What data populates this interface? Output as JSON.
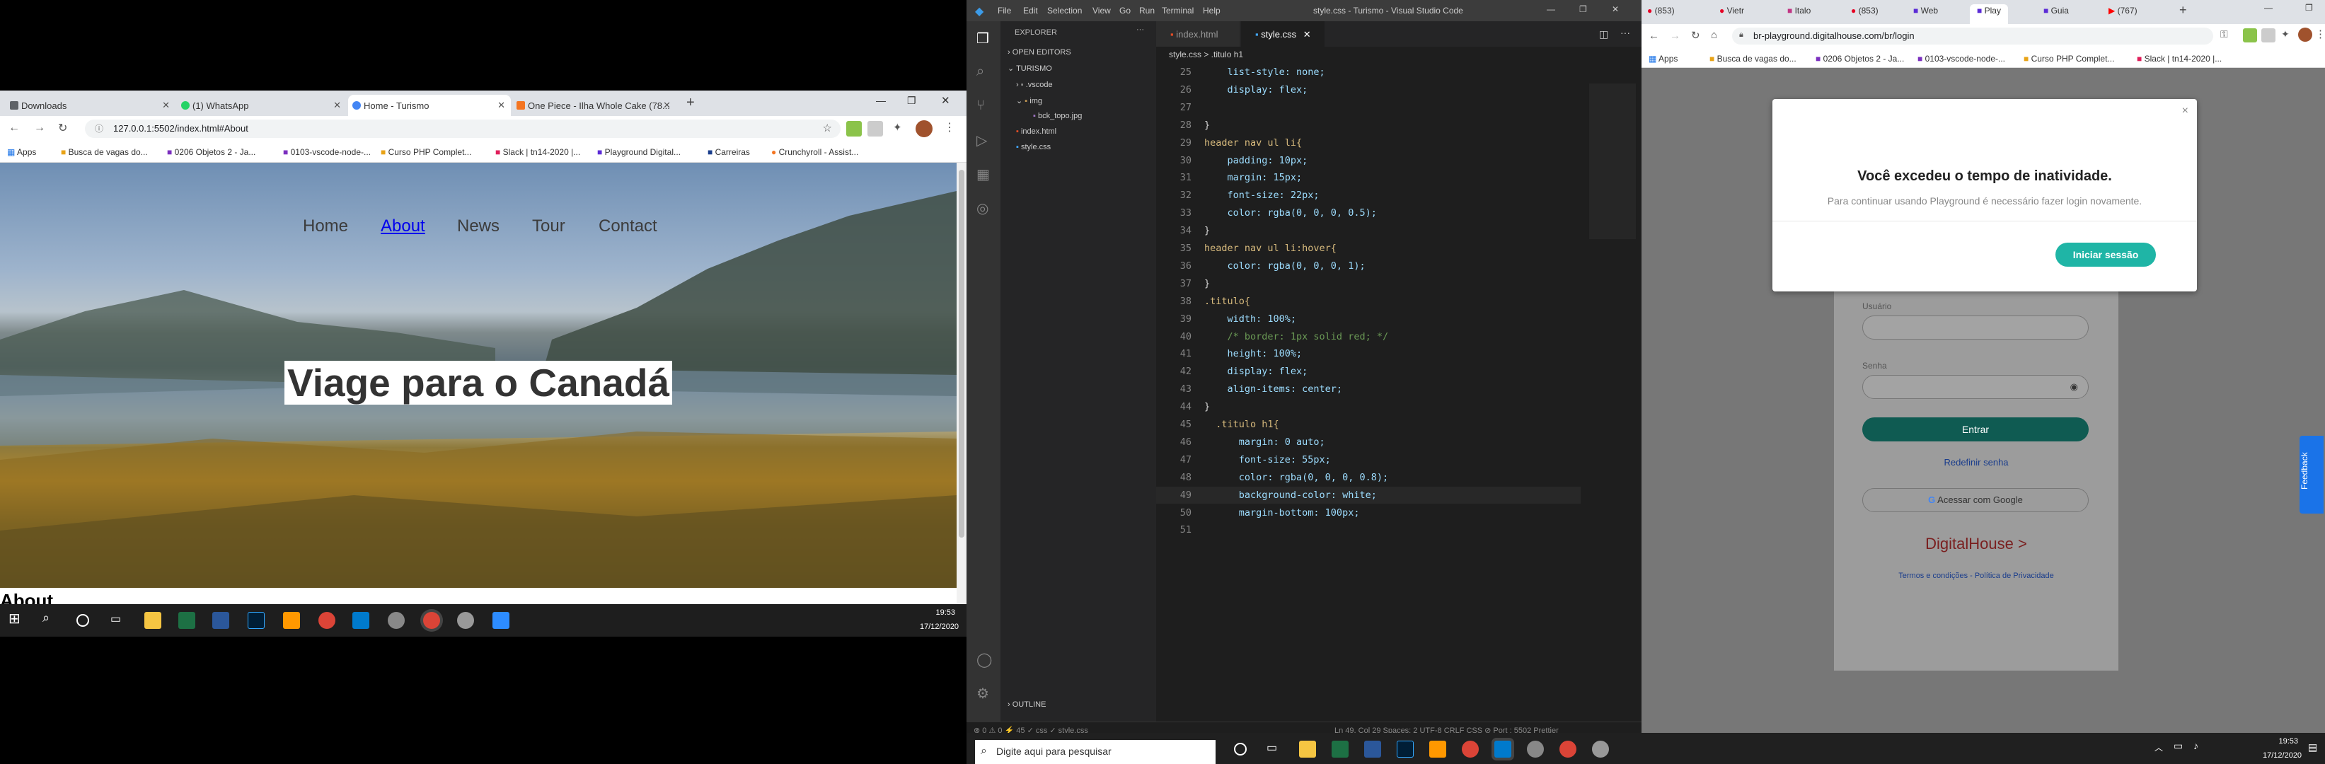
{
  "left_browser": {
    "tabs": [
      {
        "label": "Downloads"
      },
      {
        "label": "(1) WhatsApp"
      },
      {
        "label": "Home - Turismo"
      },
      {
        "label": "One Piece - Ilha Whole Cake (78..."
      }
    ],
    "url": "127.0.0.1:5502/index.html#About",
    "bookmarks": [
      "Apps",
      "Busca de vagas do...",
      "0206 Objetos 2 - Ja...",
      "0103-vscode-node-...",
      "Curso PHP Complet...",
      "Slack | tn14-2020 |...",
      "Playground Digital...",
      "Carreiras",
      "Crunchyroll - Assist..."
    ],
    "page": {
      "nav": [
        "Home",
        "About",
        "News",
        "Tour",
        "Contact"
      ],
      "active_nav": "About",
      "hero_title": "Viage para o Canadá",
      "section_heading": "About"
    },
    "taskbar_clock": {
      "time": "19:53",
      "date": "17/12/2020"
    }
  },
  "vscode": {
    "window_title": "style.css - Turismo - Visual Studio Code",
    "menu": [
      "File",
      "Edit",
      "Selection",
      "View",
      "Go",
      "Run",
      "Terminal",
      "Help"
    ],
    "explorer": {
      "title": "EXPLORER",
      "open_editors": "OPEN EDITORS",
      "project": "TURISMO",
      "items": [
        ".vscode",
        "img",
        "bck_topo.jpg",
        "index.html",
        "style.css"
      ],
      "outline": "OUTLINE"
    },
    "tabs": [
      "index.html",
      "style.css"
    ],
    "breadcrumb": "style.css > .titulo h1",
    "code_lines": [
      {
        "n": "25",
        "t": "    list-style: none;"
      },
      {
        "n": "26",
        "t": "    display: flex;"
      },
      {
        "n": "27",
        "t": ""
      },
      {
        "n": "28",
        "t": "}"
      },
      {
        "n": "29",
        "t": "header nav ul li{"
      },
      {
        "n": "30",
        "t": "    padding: 10px;"
      },
      {
        "n": "31",
        "t": "    margin: 15px;"
      },
      {
        "n": "32",
        "t": "    font-size: 22px;"
      },
      {
        "n": "33",
        "t": "    color: rgba(0, 0, 0, 0.5);"
      },
      {
        "n": "34",
        "t": "}"
      },
      {
        "n": "35",
        "t": "header nav ul li:hover{"
      },
      {
        "n": "36",
        "t": "    color: rgba(0, 0, 0, 1);"
      },
      {
        "n": "37",
        "t": "}"
      },
      {
        "n": "38",
        "t": ".titulo{"
      },
      {
        "n": "39",
        "t": "    width: 100%;"
      },
      {
        "n": "40",
        "t": "    /* border: 1px solid red; */"
      },
      {
        "n": "41",
        "t": "    height: 100%;"
      },
      {
        "n": "42",
        "t": "    display: flex;"
      },
      {
        "n": "43",
        "t": "    align-items: center;"
      },
      {
        "n": "44",
        "t": "}"
      },
      {
        "n": "45",
        "t": "  .titulo h1{"
      },
      {
        "n": "46",
        "t": "      margin: 0 auto;"
      },
      {
        "n": "47",
        "t": "      font-size: 55px;"
      },
      {
        "n": "48",
        "t": "      color: rgba(0, 0, 0, 0.8);"
      },
      {
        "n": "49",
        "t": "      background-color: white;"
      },
      {
        "n": "50",
        "t": "      margin-bottom: 100px;"
      },
      {
        "n": "51",
        "t": ""
      }
    ],
    "statusbar": {
      "left": "⊗ 0 ⚠ 0  ⚡ 45   ✓ css  ✓ style.css",
      "right": "Ln 49, Col 29   Spaces: 2   UTF-8   CRLF   CSS   ⊘ Port : 5502   Prettier"
    },
    "taskbar_search": "Digite aqui para pesquisar"
  },
  "right_browser": {
    "tabs": [
      "(853)",
      "Vietr",
      "Italo",
      "(853)",
      "Web",
      "Play",
      "Guia",
      "(767)"
    ],
    "url": "br-playground.digitalhouse.com/br/login",
    "bookmarks": [
      "Apps",
      "Busca de vagas do...",
      "0206 Objetos 2 - Ja...",
      "0103-vscode-node-...",
      "Curso PHP Complet...",
      "Slack | tn14-2020 |..."
    ],
    "modal": {
      "title": "Você excedeu o tempo de inatividade.",
      "message": "Para continuar usando Playground é necessário fazer login novamente.",
      "button": "Iniciar sessão"
    },
    "login": {
      "user_label": "Usuário",
      "password_label": "Senha",
      "submit": "Entrar",
      "reset": "Redefinir senha",
      "google": "Acessar com Google",
      "brand": "DigitalHouse >",
      "footer": "Termos e condições - Política de Privacidade",
      "feedback": "Feedback"
    },
    "taskbar_clock": {
      "time": "19:53",
      "date": "17/12/2020"
    }
  }
}
